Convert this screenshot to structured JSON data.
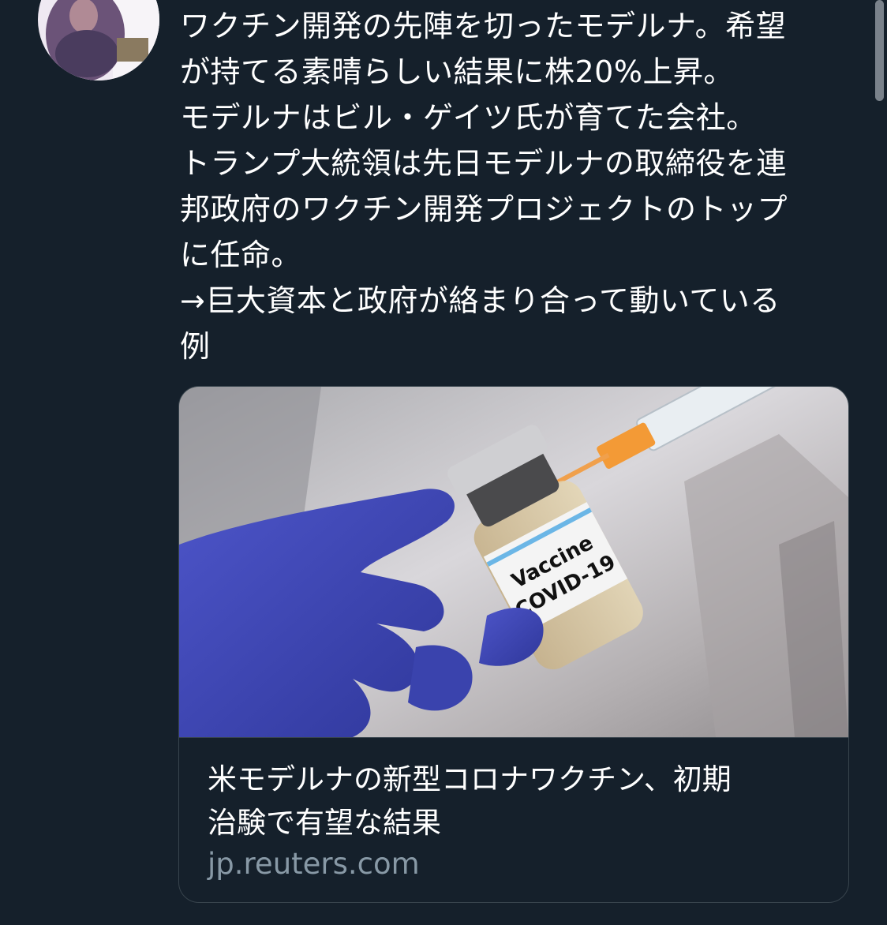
{
  "tweet": {
    "text_lines": [
      "ワクチン開発の先陣を切ったモデルナ。希望",
      "が持てる素晴らしい結果に株20%上昇。",
      "モデルナはビル・ゲイツ氏が育てた会社。",
      "トランプ大統領は先日モデルナの取締役を連",
      "邦政府のワクチン開発プロジェクトのトップ",
      "に任命。",
      "→巨大資本と政府が絡まり合って動いている",
      "例"
    ]
  },
  "card": {
    "image": {
      "vial_label_line1": "Vaccine",
      "vial_label_line2": "COVID-19"
    },
    "title_lines": [
      "米モデルナの新型コロナワクチン、初期",
      "治験で有望な結果"
    ],
    "domain": "jp.reuters.com"
  },
  "colors": {
    "background": "#15202b",
    "text": "#ffffff",
    "secondary_text": "#8899a6",
    "border": "#38444d"
  }
}
